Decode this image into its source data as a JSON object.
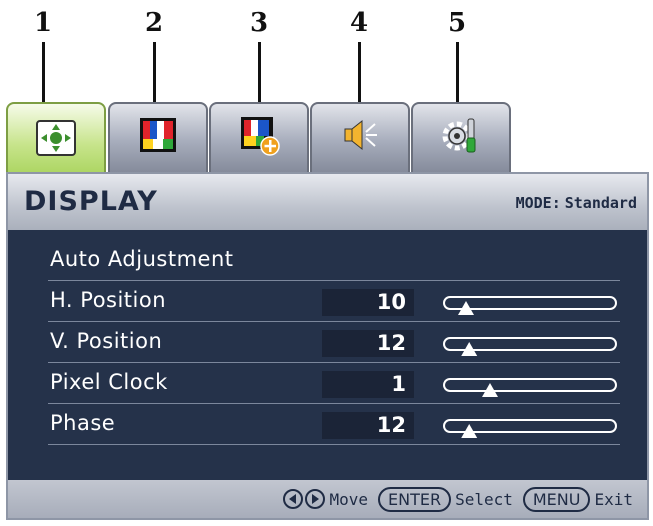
{
  "callouts": [
    "1",
    "2",
    "3",
    "4",
    "5"
  ],
  "tabs": [
    {
      "icon": "display-position-icon",
      "active": true
    },
    {
      "icon": "color-bars-icon",
      "active": false
    },
    {
      "icon": "picture-advanced-icon",
      "active": false
    },
    {
      "icon": "speaker-audio-icon",
      "active": false
    },
    {
      "icon": "system-settings-icon",
      "active": false
    }
  ],
  "header": {
    "title": "DISPLAY",
    "mode_label": "MODE:",
    "mode_value": "Standard"
  },
  "rows": [
    {
      "label": "Auto Adjustment"
    },
    {
      "label": "H. Position",
      "value": "10",
      "level": 0.1
    },
    {
      "label": "V. Position",
      "value": "12",
      "level": 0.12
    },
    {
      "label": "Pixel Clock",
      "value": "1",
      "level": 0.25
    },
    {
      "label": "Phase",
      "value": "12",
      "level": 0.12
    }
  ],
  "footer": {
    "move": "Move",
    "enter": "ENTER",
    "select": "Select",
    "menu": "MENU",
    "exit": "Exit"
  },
  "colors": {
    "osd_bg": "#25324a",
    "active_tab": "#a8d35c",
    "header": "#bec3cd"
  }
}
